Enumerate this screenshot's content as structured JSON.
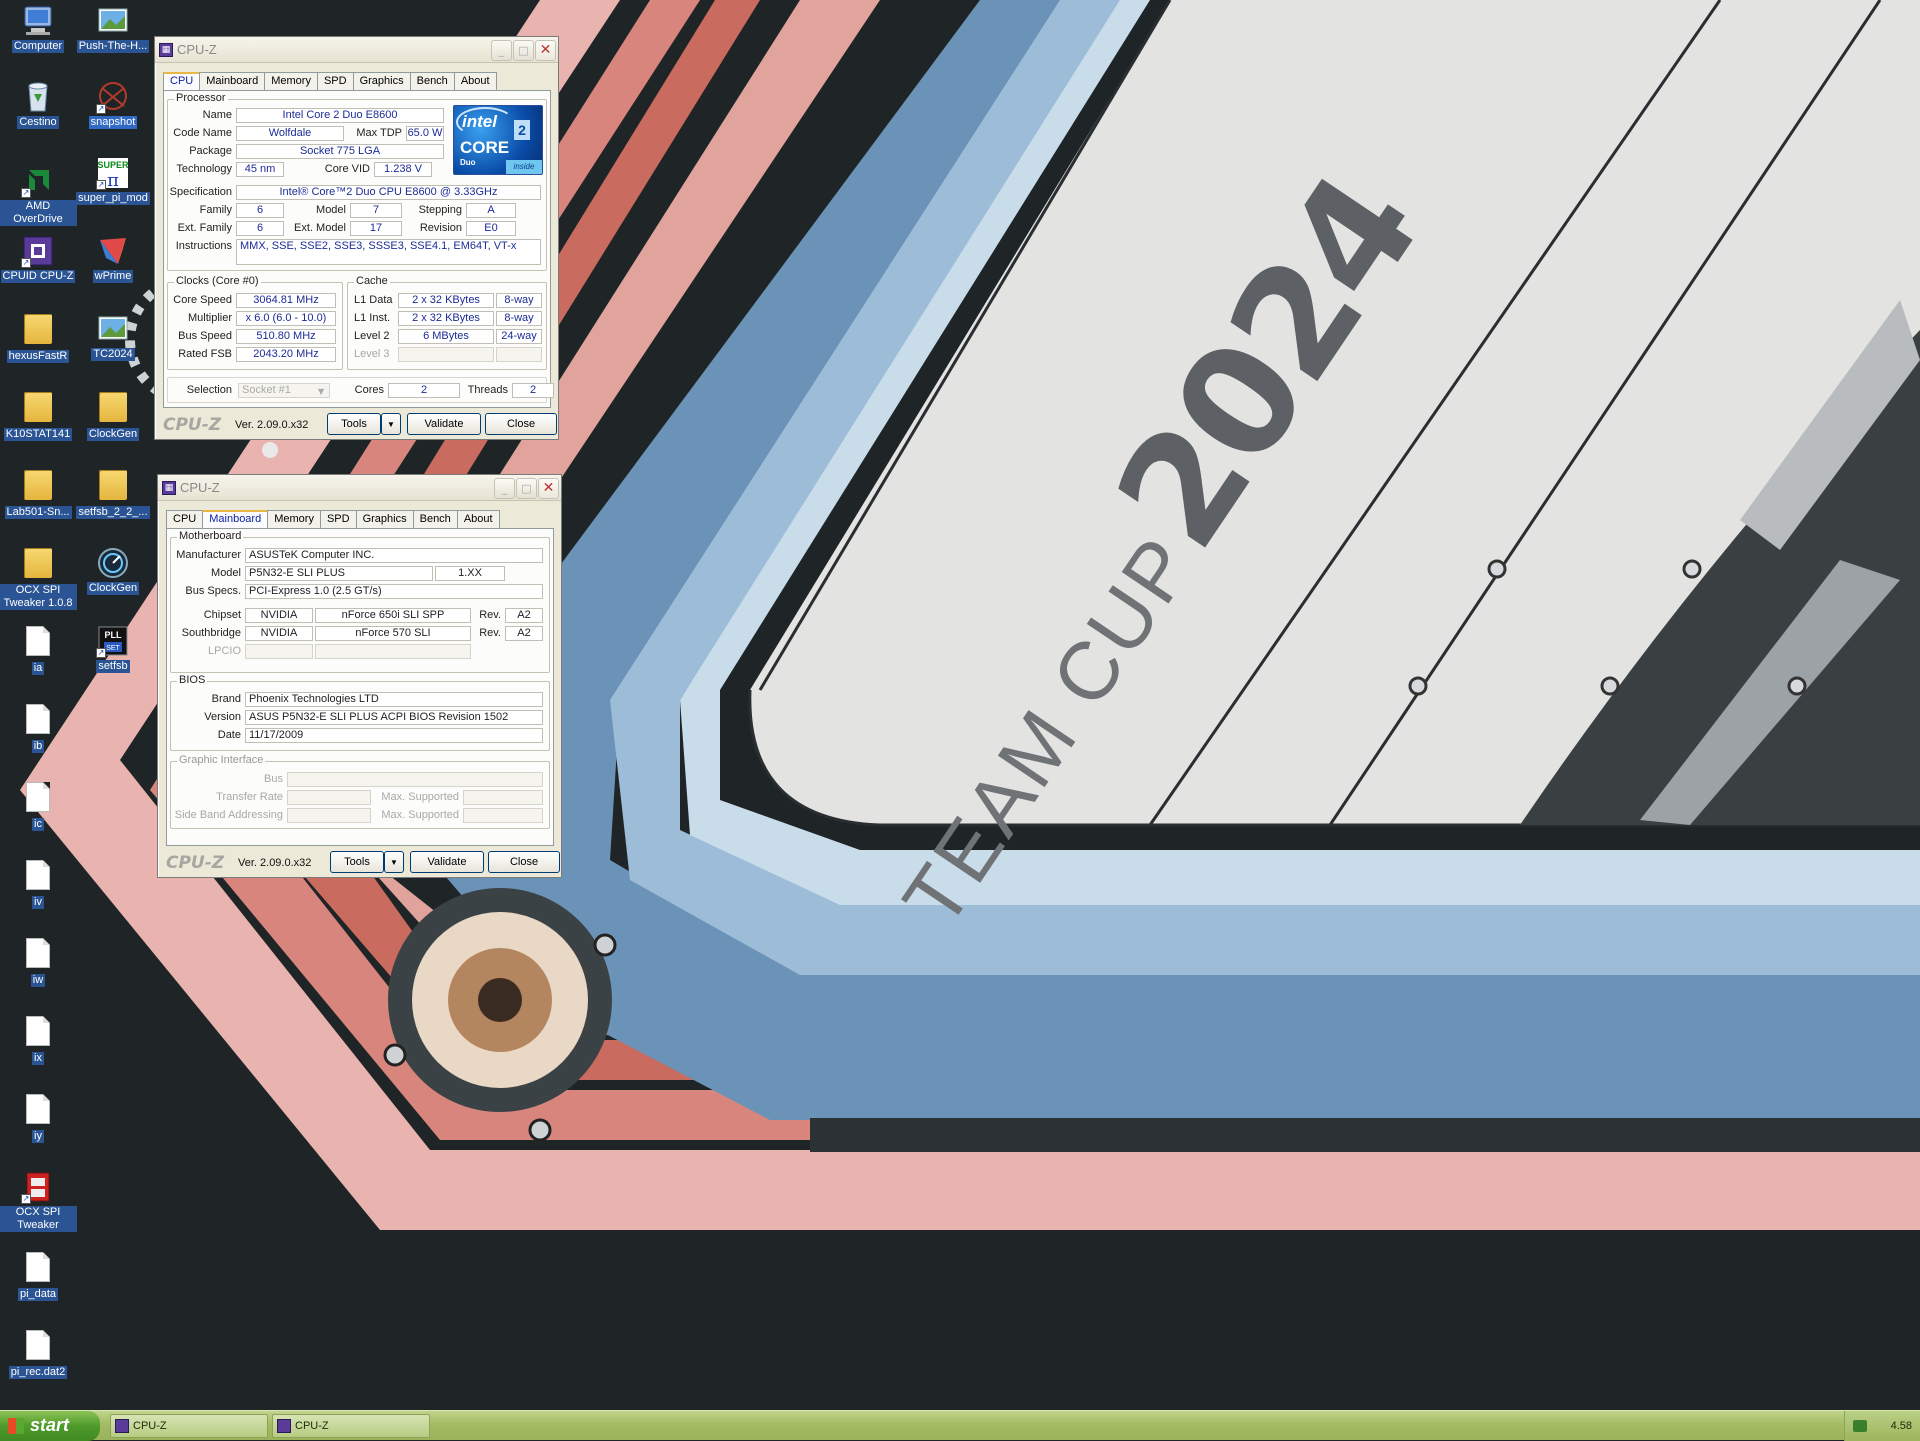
{
  "desktop_icons": [
    {
      "label": "Computer",
      "kind": "computer"
    },
    {
      "label": "Push-The-H...",
      "kind": "image"
    },
    {
      "label": "Cestino",
      "kind": "trash"
    },
    {
      "label": "snapshot",
      "kind": "app"
    },
    {
      "label": "AMD OverDrive",
      "kind": "app"
    },
    {
      "label": "super_pi_mod",
      "kind": "app"
    },
    {
      "label": "CPUID CPU-Z",
      "kind": "app"
    },
    {
      "label": "wPrime",
      "kind": "app"
    },
    {
      "label": "hexusFastR",
      "kind": "folder"
    },
    {
      "label": "TC2024",
      "kind": "image"
    },
    {
      "label": "K10STAT141",
      "kind": "folder"
    },
    {
      "label": "ClockGen",
      "kind": "folder"
    },
    {
      "label": "Lab501-Sn...",
      "kind": "folder"
    },
    {
      "label": "setfsb_2_2_...",
      "kind": "folder"
    },
    {
      "label": "OCX SPI Tweaker 1.0.8",
      "kind": "folder"
    },
    {
      "label": "ClockGen",
      "kind": "app"
    },
    {
      "label": "ia",
      "kind": "file"
    },
    {
      "label": "setfsb",
      "kind": "app"
    },
    {
      "label": "ib",
      "kind": "file"
    },
    {
      "label": "ic",
      "kind": "file"
    },
    {
      "label": "iv",
      "kind": "file"
    },
    {
      "label": "iw",
      "kind": "file"
    },
    {
      "label": "ix",
      "kind": "file"
    },
    {
      "label": "iy",
      "kind": "file"
    },
    {
      "label": "OCX SPI Tweaker",
      "kind": "app"
    },
    {
      "label": "pi_data",
      "kind": "file"
    },
    {
      "label": "pi_rec.dat2",
      "kind": "file"
    }
  ],
  "wallpaper": {
    "text_small": "TEAM CUP",
    "text_big": "2024"
  },
  "cpu_window": {
    "title": "CPU-Z",
    "tabs": [
      "CPU",
      "Mainboard",
      "Memory",
      "SPD",
      "Graphics",
      "Bench",
      "About"
    ],
    "processor": {
      "group": "Processor",
      "name_label": "Name",
      "name": "Intel Core 2 Duo E8600",
      "codename_label": "Code Name",
      "codename": "Wolfdale",
      "maxtdp_label": "Max TDP",
      "maxtdp": "65.0 W",
      "package_label": "Package",
      "package": "Socket 775 LGA",
      "technology_label": "Technology",
      "technology": "45 nm",
      "corevid_label": "Core VID",
      "corevid": "1.238 V",
      "spec_label": "Specification",
      "spec": "Intel® Core™2 Duo CPU     E8600  @ 3.33GHz",
      "family_label": "Family",
      "family": "6",
      "model_label": "Model",
      "model": "7",
      "stepping_label": "Stepping",
      "stepping": "A",
      "extfamily_label": "Ext. Family",
      "extfamily": "6",
      "extmodel_label": "Ext. Model",
      "extmodel": "17",
      "revision_label": "Revision",
      "revision": "E0",
      "instructions_label": "Instructions",
      "instructions": "MMX, SSE, SSE2, SSE3, SSSE3, SSE4.1, EM64T, VT-x"
    },
    "logo": {
      "brand": "intel",
      "line": "CORE",
      "sub": "Duo",
      "badge": "inside",
      "num": "2"
    },
    "clocks": {
      "group": "Clocks (Core #0)",
      "corespeed_label": "Core Speed",
      "corespeed": "3064.81 MHz",
      "multiplier_label": "Multiplier",
      "multiplier": "x 6.0 (6.0 - 10.0)",
      "busspeed_label": "Bus Speed",
      "busspeed": "510.80 MHz",
      "ratedfsb_label": "Rated FSB",
      "ratedfsb": "2043.20 MHz"
    },
    "cache": {
      "group": "Cache",
      "l1d_label": "L1 Data",
      "l1d": "2 x 32 KBytes",
      "l1d_way": "8-way",
      "l1i_label": "L1 Inst.",
      "l1i": "2 x 32 KBytes",
      "l1i_way": "8-way",
      "l2_label": "Level 2",
      "l2": "6 MBytes",
      "l2_way": "24-way",
      "l3_label": "Level 3"
    },
    "selection_label": "Selection",
    "selection": "Socket #1",
    "cores_label": "Cores",
    "cores": "2",
    "threads_label": "Threads",
    "threads": "2",
    "footer": {
      "logo": "CPU-Z",
      "version": "Ver. 2.09.0.x32",
      "tools": "Tools",
      "validate": "Validate",
      "close": "Close"
    }
  },
  "mb_window": {
    "title": "CPU-Z",
    "tabs": [
      "CPU",
      "Mainboard",
      "Memory",
      "SPD",
      "Graphics",
      "Bench",
      "About"
    ],
    "motherboard": {
      "group": "Motherboard",
      "manufacturer_label": "Manufacturer",
      "manufacturer": "ASUSTeK Computer INC.",
      "model_label": "Model",
      "model": "P5N32-E SLI PLUS",
      "model_rev": "1.XX",
      "busspecs_label": "Bus Specs.",
      "busspecs": "PCI-Express 1.0 (2.5 GT/s)",
      "chipset_label": "Chipset",
      "chipset_vendor": "NVIDIA",
      "chipset_name": "nForce 650i SLI SPP",
      "chipset_rev_label": "Rev.",
      "chipset_rev": "A2",
      "south_label": "Southbridge",
      "south_vendor": "NVIDIA",
      "south_name": "nForce 570 SLI",
      "south_rev_label": "Rev.",
      "south_rev": "A2",
      "lpcio_label": "LPCIO"
    },
    "bios": {
      "group": "BIOS",
      "brand_label": "Brand",
      "brand": "Phoenix Technologies LTD",
      "version_label": "Version",
      "version": "ASUS P5N32-E SLI PLUS ACPI BIOS Revision 1502",
      "date_label": "Date",
      "date": "11/17/2009"
    },
    "graphic": {
      "group": "Graphic Interface",
      "bus_label": "Bus",
      "transfer_label": "Transfer Rate",
      "maxsup1_label": "Max. Supported",
      "sideband_label": "Side Band Addressing",
      "maxsup2_label": "Max. Supported"
    },
    "footer": {
      "logo": "CPU-Z",
      "version": "Ver. 2.09.0.x32",
      "tools": "Tools",
      "validate": "Validate",
      "close": "Close"
    }
  },
  "taskbar": {
    "start": "start",
    "tasks": [
      "CPU-Z",
      "CPU-Z"
    ],
    "clock": "4.58"
  },
  "colors": {
    "accent": "#0b24a5",
    "value_text": "#1c2c96",
    "taskbar": "#a5bc65",
    "start": "#4e9a2a"
  }
}
